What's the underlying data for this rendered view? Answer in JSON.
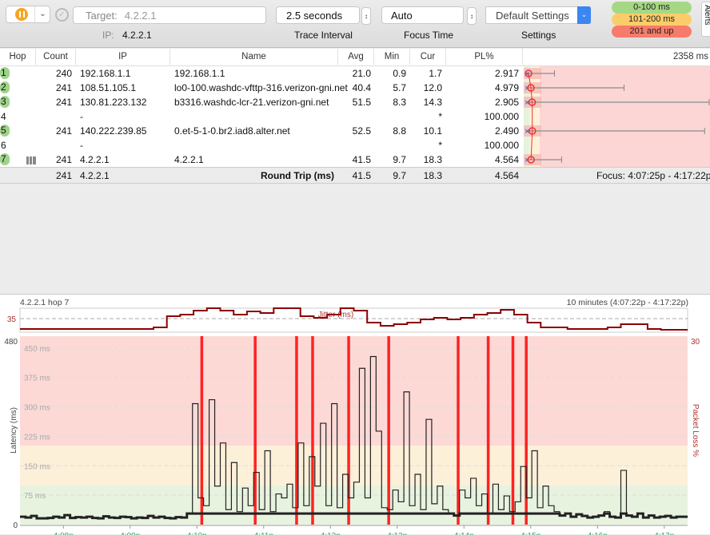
{
  "toolbar": {
    "pause_icon": "pause-icon",
    "target_label": "Target:",
    "target_value": "4.2.2.1",
    "ip_label": "IP:",
    "ip_value": "4.2.2.1",
    "trace_interval": "2.5 seconds",
    "trace_interval_label": "Trace Interval",
    "focus_time": "Auto",
    "focus_time_label": "Focus Time",
    "settings": "Default Settings",
    "settings_label": "Settings",
    "legend": [
      {
        "label": "0-100 ms",
        "color": "#a6d785"
      },
      {
        "label": "101-200 ms",
        "color": "#fbcd6a"
      },
      {
        "label": "201 and up",
        "color": "#f77b6a"
      }
    ],
    "alerts_tab": "Alerts"
  },
  "table": {
    "columns": [
      "Hop",
      "Count",
      "IP",
      "Name",
      "Avg",
      "Min",
      "Cur",
      "PL%"
    ],
    "scale_max": "2358 ms",
    "rows": [
      {
        "hop": "1",
        "count": "240",
        "ip": "192.168.1.1",
        "name": "192.168.1.1",
        "avg": "21.0",
        "min": "0.9",
        "cur": "1.7",
        "pl": "2.917",
        "max_ms": 390
      },
      {
        "hop": "2",
        "count": "241",
        "ip": "108.51.105.1",
        "name": "lo0-100.washdc-vfttp-316.verizon-gni.net",
        "avg": "40.4",
        "min": "5.7",
        "cur": "12.0",
        "pl": "4.979",
        "max_ms": 1270
      },
      {
        "hop": "3",
        "count": "241",
        "ip": "130.81.223.132",
        "name": "b3316.washdc-lcr-21.verizon-gni.net",
        "avg": "51.5",
        "min": "8.3",
        "cur": "14.3",
        "pl": "2.905",
        "max_ms": 2358
      },
      {
        "hop": "4",
        "count": "",
        "ip": "-",
        "name": "",
        "avg": "",
        "min": "",
        "cur": "*",
        "pl": "100.000"
      },
      {
        "hop": "5",
        "count": "241",
        "ip": "140.222.239.85",
        "name": "0.et-5-1-0.br2.iad8.alter.net",
        "avg": "52.5",
        "min": "8.8",
        "cur": "10.1",
        "pl": "2.490",
        "max_ms": 2290
      },
      {
        "hop": "6",
        "count": "",
        "ip": "-",
        "name": "",
        "avg": "",
        "min": "",
        "cur": "*",
        "pl": "100.000"
      },
      {
        "hop": "7",
        "count": "241",
        "ip": "4.2.2.1",
        "name": "4.2.2.1",
        "avg": "41.5",
        "min": "9.7",
        "cur": "18.3",
        "pl": "4.564",
        "max_ms": 480
      }
    ],
    "summary": {
      "count": "241",
      "ip": "4.2.2.1",
      "label": "Round Trip (ms)",
      "avg": "41.5",
      "min": "9.7",
      "cur": "18.3",
      "pl": "4.564",
      "focus": "Focus: 4:07:25p - 4:17:22p"
    }
  },
  "graph": {
    "title": "4.2.2.1 hop 7",
    "range": "10 minutes (4:07:22p - 4:17:22p)",
    "jitter_label": "Jitter (ms)",
    "jitter_tick": "35",
    "y_top": "480",
    "y_zero": "0",
    "pl_top": "30",
    "ylabel": "Latency (ms)",
    "y2label": "Packet Loss %",
    "gridlines": [
      "450 ms",
      "375 ms",
      "300 ms",
      "225 ms",
      "150 ms",
      "75 ms"
    ],
    "time_ticks": [
      "4:08p",
      "4:09p",
      "4:10p",
      "4:11p",
      "4:12p",
      "4:13p",
      "4:14p",
      "4:15p",
      "4:16p",
      "4:17p"
    ],
    "latency_ms": [
      12,
      10,
      14,
      8,
      8,
      9,
      12,
      10,
      16,
      9,
      11,
      10,
      12,
      9,
      8,
      13,
      10,
      9,
      12,
      11,
      8,
      10,
      9,
      14,
      10,
      12,
      9,
      8,
      11,
      10,
      20,
      300,
      60,
      40,
      310,
      90,
      200,
      30,
      150,
      25,
      85,
      40,
      125,
      30,
      180,
      25,
      70,
      60,
      95,
      35,
      200,
      40,
      165,
      90,
      250,
      40,
      300,
      35,
      120,
      60,
      100,
      390,
      60,
      420,
      230,
      35,
      30,
      80,
      50,
      330,
      40,
      120,
      30,
      260,
      45,
      90,
      30,
      20,
      15,
      80,
      60,
      110,
      40,
      70,
      20,
      95,
      30,
      65,
      25,
      50,
      140,
      60,
      180,
      35,
      90,
      40,
      25,
      15,
      20,
      12,
      18,
      14,
      10,
      12,
      15,
      25,
      12,
      10,
      130,
      15,
      12,
      20,
      10,
      15,
      10,
      12,
      14,
      10,
      12,
      12
    ],
    "packet_loss_minutes": [
      2.72,
      3.52,
      4.14,
      4.38,
      4.92,
      5.52,
      6.56,
      7.01,
      7.38,
      7.58
    ],
    "jitter_ms": [
      22,
      22,
      22,
      22,
      22,
      22,
      22,
      22,
      22,
      22,
      24,
      38,
      40,
      45,
      50,
      45,
      40,
      44,
      42,
      48,
      50,
      38,
      36,
      40,
      48,
      45,
      30,
      26,
      28,
      30,
      34,
      36,
      34,
      36,
      40,
      42,
      46,
      40,
      30,
      24,
      24,
      22,
      22,
      22,
      24,
      28,
      28,
      22,
      21,
      21
    ]
  }
}
